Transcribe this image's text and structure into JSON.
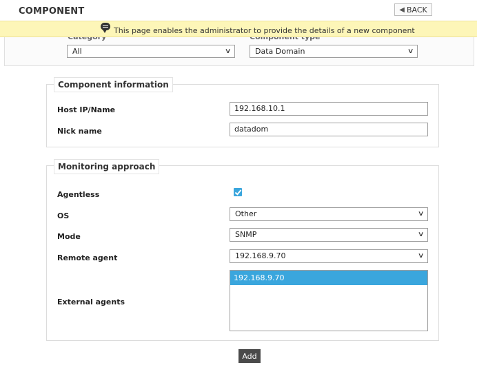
{
  "header": {
    "title": "COMPONENT",
    "back_label": "BACK"
  },
  "banner": {
    "text": "This page enables the administrator to provide the details of a new component"
  },
  "filters": {
    "category_label": "Category",
    "category_value": "All",
    "component_type_label": "Component type",
    "component_type_value": "Data Domain"
  },
  "component_info": {
    "legend": "Component information",
    "host_label": "Host IP/Name",
    "host_value": "192.168.10.1",
    "nick_label": "Nick name",
    "nick_value": "datadom"
  },
  "monitoring": {
    "legend": "Monitoring approach",
    "agentless_label": "Agentless",
    "agentless_checked": true,
    "os_label": "OS",
    "os_value": "Other",
    "mode_label": "Mode",
    "mode_value": "SNMP",
    "remote_label": "Remote agent",
    "remote_value": "192.168.9.70",
    "external_label": "External agents",
    "external_options": [
      "192.168.9.70"
    ]
  },
  "actions": {
    "add_label": "Add"
  },
  "colors": {
    "accent": "#3aa6dd",
    "banner": "#fdf6b8",
    "button": "#4a4a4a"
  }
}
